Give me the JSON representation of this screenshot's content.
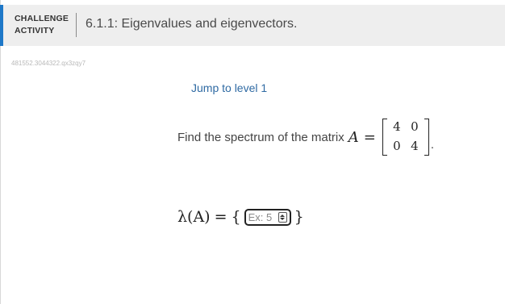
{
  "header": {
    "label_line1": "CHALLENGE",
    "label_line2": "ACTIVITY",
    "title": "6.1.1: Eigenvalues and eigenvectors."
  },
  "activity_id": "481552.3044322.qx3zqy7",
  "jump_link": "Jump to level 1",
  "question": {
    "prompt": "Find the spectrum of the matrix",
    "variable": "A",
    "equals": "=",
    "matrix": [
      [
        "4",
        "0"
      ],
      [
        "0",
        "4"
      ]
    ],
    "end": "."
  },
  "answer": {
    "lhs": "λ(A)",
    "equals": "=",
    "open_brace": "{",
    "close_brace": "}",
    "placeholder": "Ex: 5"
  },
  "colors": {
    "accent": "#1e78c8",
    "link": "#2f6aa3",
    "header_bg": "#eeeeee"
  }
}
